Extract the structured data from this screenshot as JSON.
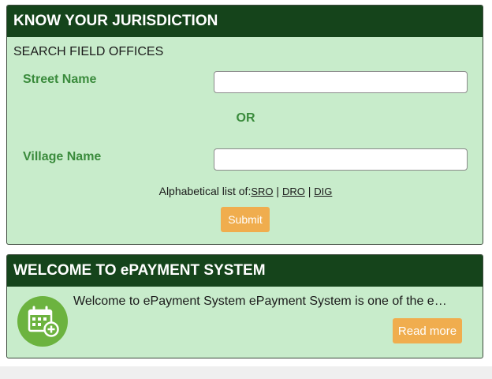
{
  "jurisdiction": {
    "header": "KNOW YOUR JURISDICTION",
    "subtitle": "SEARCH FIELD OFFICES",
    "street_label": "Street Name",
    "street_value": "",
    "or_text": "OR",
    "village_label": "Village Name",
    "village_value": "",
    "alpha_prefix": "Alphabetical list of:",
    "links": [
      "SRO",
      "DRO",
      "DIG"
    ],
    "separator": "|",
    "submit_label": "Submit"
  },
  "epayment": {
    "header": "WELCOME TO ePAYMENT SYSTEM",
    "text": "Welcome to ePayment System ePayment System is one of the e…",
    "read_more_label": "Read more",
    "icon": "calendar-icon"
  },
  "colors": {
    "header_bg": "#15441b",
    "panel_bg": "#c8eccb",
    "label_green": "#3a8b3c",
    "button_orange": "#f0ad4e",
    "icon_circle": "#6cb33f"
  }
}
